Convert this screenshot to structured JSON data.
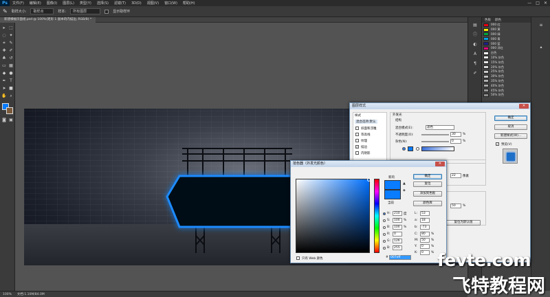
{
  "menubar": {
    "logo": "Ps",
    "items": [
      "文件(F)",
      "编辑(E)",
      "图像(I)",
      "图层(L)",
      "类型(Y)",
      "选择(S)",
      "滤镜(T)",
      "3D(D)",
      "视图(V)",
      "窗口(W)",
      "帮助(H)"
    ],
    "minimize": "—",
    "restore": "□",
    "close": "✕"
  },
  "optionsbar": {
    "tool_icon": "eyedropper-icon",
    "sample_size_label": "取样大小:",
    "sample_size_value": "取样点",
    "sample_label": "样本:",
    "sample_value": "所有图层",
    "show_ring_label": "显示取样环"
  },
  "document": {
    "tab_title": "新建横幅页面组.psd @ 100%(矩形 1 副本的内描边, RGB/8) *"
  },
  "statusbar": {
    "zoom": "100%",
    "doc_size": "文档:1.10M/84.0M"
  },
  "swatches_panel": {
    "tabs": [
      "色板",
      "颜色"
    ],
    "rows": [
      {
        "color": "#e60012",
        "label": "000 红"
      },
      {
        "color": "#fff100",
        "label": "000 黄"
      },
      {
        "color": "#00a73c",
        "label": "000 绿"
      },
      {
        "color": "#00a0e9",
        "label": "000 青"
      },
      {
        "color": "#1d2088",
        "label": "000 蓝"
      },
      {
        "color": "#e4007f",
        "label": "000 洋红"
      },
      {
        "color": "#ffffff",
        "label": "白色"
      },
      {
        "color": "#f2f2f2",
        "label": "10% 灰色"
      },
      {
        "color": "#e6e6e6",
        "label": "15% 灰色"
      },
      {
        "color": "#d9d9d9",
        "label": "20% 灰色"
      },
      {
        "color": "#cccccc",
        "label": "25% 灰色"
      },
      {
        "color": "#bfbfbf",
        "label": "30% 灰色"
      },
      {
        "color": "#b3b3b3",
        "label": "35% 灰色"
      },
      {
        "color": "#a6a6a6",
        "label": "40% 灰色"
      },
      {
        "color": "#999999",
        "label": "45% 灰色"
      },
      {
        "color": "#8c8c8c",
        "label": "50% 灰色"
      }
    ]
  },
  "layer_style_dialog": {
    "title": "图层样式",
    "styles_header": "样式",
    "blend_options": "混合选项:默认",
    "items": [
      {
        "label": "斜面和浮雕",
        "checked": false
      },
      {
        "label": "等高线",
        "checked": false
      },
      {
        "label": "纹理",
        "checked": false
      },
      {
        "label": "描边",
        "checked": true
      },
      {
        "label": "内阴影",
        "checked": false
      }
    ],
    "section_title": "外发光",
    "structure_label": "结构",
    "blend_mode_label": "混合模式(E):",
    "blend_mode_value": "滤色",
    "opacity_label": "不透明度(O):",
    "opacity_value": "30",
    "noise_label": "杂色(N):",
    "noise_value": "0",
    "percent": "%",
    "elements_label": "图素",
    "size_value": "22",
    "size_unit": "像素",
    "quality_label": "品质",
    "range_value": "50",
    "reset_default": "复位为默认值",
    "ok": "确定",
    "cancel": "取消",
    "new_style": "新建样式(W)...",
    "preview_label": "预览(V)",
    "glow_color": "#0a7cff"
  },
  "color_picker_dialog": {
    "title": "拾色器（外发光颜色）",
    "new_label": "新的",
    "current_label": "当前",
    "ok": "确定",
    "cancel": "复位",
    "add_to_swatches": "添加到色板",
    "color_libraries": "颜色库",
    "fields": [
      {
        "label": "H:",
        "value": "210",
        "unit": "度"
      },
      {
        "label": "S:",
        "value": "100",
        "unit": "%"
      },
      {
        "label": "B:",
        "value": "100",
        "unit": "%"
      },
      {
        "label": "R:",
        "value": "0",
        "unit": ""
      },
      {
        "label": "G:",
        "value": "126",
        "unit": ""
      },
      {
        "label": "B:",
        "value": "255",
        "unit": ""
      }
    ],
    "lab_fields": [
      {
        "label": "L:",
        "value": "53"
      },
      {
        "label": "a:",
        "value": "18"
      },
      {
        "label": "b:",
        "value": "-73"
      }
    ],
    "cmyk_fields": [
      {
        "label": "C:",
        "value": "80",
        "unit": "%"
      },
      {
        "label": "M:",
        "value": "50",
        "unit": "%"
      },
      {
        "label": "Y:",
        "value": "0",
        "unit": "%"
      },
      {
        "label": "K:",
        "value": "0",
        "unit": "%"
      }
    ],
    "hex_label": "#",
    "hex_value": "007eff",
    "web_only_label": "只有 Web 颜色",
    "selected_color": "#0a7cff",
    "hue_color": "#0070ff"
  },
  "watermark": {
    "line1": "fevte.com",
    "line2": "飞特教程网"
  }
}
